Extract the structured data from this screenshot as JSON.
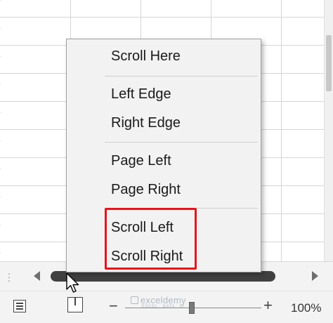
{
  "context_menu": {
    "items": [
      {
        "label": "Scroll Here"
      },
      {
        "label": "Left Edge"
      },
      {
        "label": "Right Edge"
      },
      {
        "label": "Page Left"
      },
      {
        "label": "Page Right"
      },
      {
        "label": "Scroll Left"
      },
      {
        "label": "Scroll Right"
      }
    ],
    "highlighted_items": [
      "Scroll Left",
      "Scroll Right"
    ]
  },
  "status_bar": {
    "zoom_minus": "−",
    "zoom_plus": "+",
    "zoom_level": "100%"
  },
  "watermark": {
    "name": "exceldemy",
    "tagline": "EXCEL · DATA · BI"
  },
  "colors": {
    "highlight": "#e8131a",
    "scrollbar_thumb": "#404040",
    "menu_background": "#f2f2f2"
  },
  "icons": [
    "split-handle-icon",
    "scroll-left-arrow-icon",
    "scroll-right-arrow-icon",
    "normal-view-icon",
    "page-layout-view-icon",
    "mouse-pointer-icon"
  ]
}
